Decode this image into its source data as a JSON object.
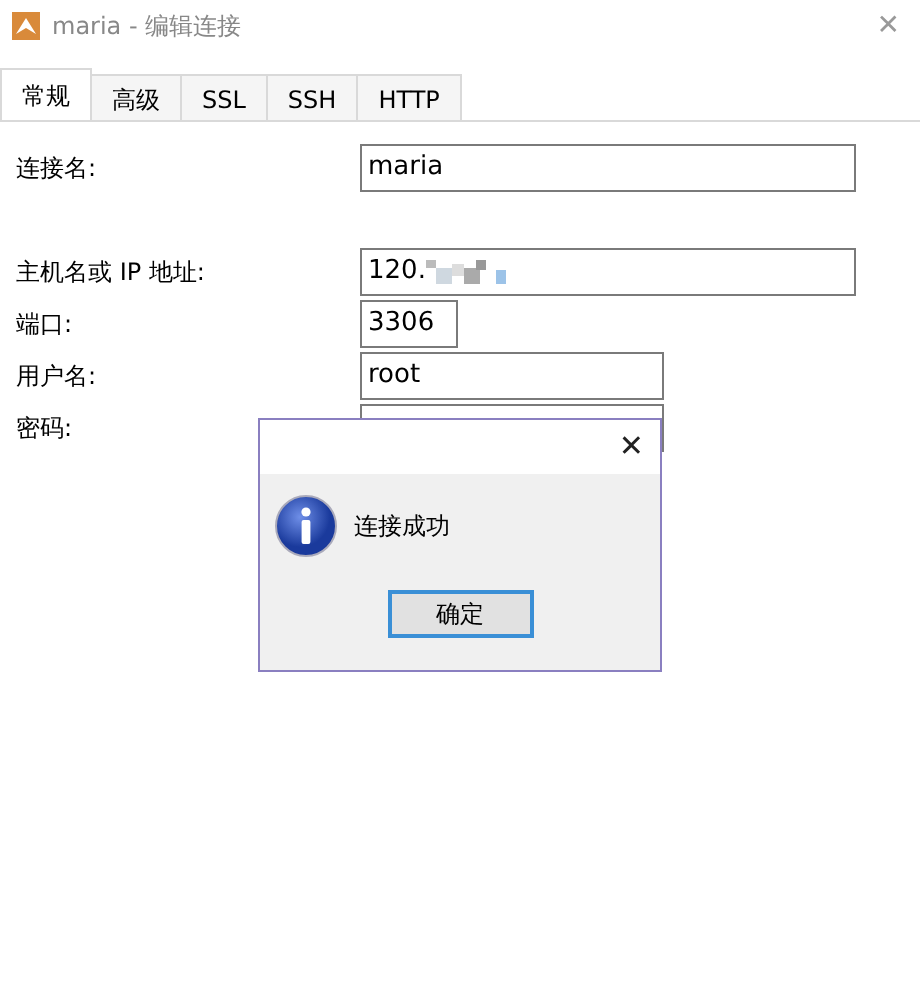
{
  "window": {
    "title": "maria - 编辑连接",
    "close": "✕"
  },
  "tabs": [
    {
      "label": "常规",
      "selected": true
    },
    {
      "label": "高级",
      "selected": false
    },
    {
      "label": "SSL",
      "selected": false
    },
    {
      "label": "SSH",
      "selected": false
    },
    {
      "label": "HTTP",
      "selected": false
    }
  ],
  "fields": [
    {
      "label": "连接名:",
      "value": "maria"
    },
    {
      "label": "主机名或 IP 地址:",
      "value": "120."
    },
    {
      "label": "端口:",
      "value": "3306"
    },
    {
      "label": "用户名:",
      "value": "root"
    },
    {
      "label": "密码:"
    }
  ],
  "dialog": {
    "close": "✕",
    "message": "连接成功",
    "button": "确定"
  }
}
